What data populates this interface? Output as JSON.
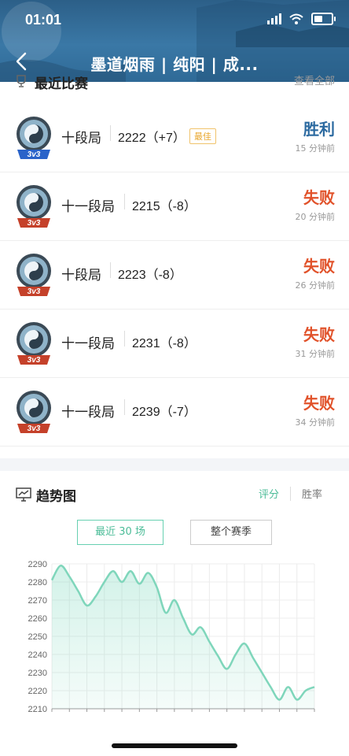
{
  "status": {
    "time": "01:01"
  },
  "header": {
    "title": "墨道烟雨 | 纯阳 | 成..."
  },
  "recent": {
    "title": "最近比赛",
    "more": "查看全部",
    "matches": [
      {
        "tier": "十段局",
        "score": "2222（+7）",
        "badge": "最佳",
        "result": "胜利",
        "result_type": "win",
        "ago": "15 分钟前",
        "mode": "3v3",
        "badge_color": "#2a63c9"
      },
      {
        "tier": "十一段局",
        "score": "2215（-8）",
        "badge": "",
        "result": "失败",
        "result_type": "lose",
        "ago": "20 分钟前",
        "mode": "3v3",
        "badge_color": "#c5412a"
      },
      {
        "tier": "十段局",
        "score": "2223（-8）",
        "badge": "",
        "result": "失败",
        "result_type": "lose",
        "ago": "26 分钟前",
        "mode": "3v3",
        "badge_color": "#c5412a"
      },
      {
        "tier": "十一段局",
        "score": "2231（-8）",
        "badge": "",
        "result": "失败",
        "result_type": "lose",
        "ago": "31 分钟前",
        "mode": "3v3",
        "badge_color": "#c5412a"
      },
      {
        "tier": "十一段局",
        "score": "2239（-7）",
        "badge": "",
        "result": "失败",
        "result_type": "lose",
        "ago": "34 分钟前",
        "mode": "3v3",
        "badge_color": "#c5412a"
      }
    ]
  },
  "trend": {
    "title": "趋势图",
    "tabs": [
      "评分",
      "胜率"
    ],
    "active_tab": "评分",
    "ranges": [
      "最近 30 场",
      "整个赛季"
    ],
    "active_range": "最近 30 场"
  },
  "colors": {
    "accent": "#4cbc98",
    "win": "#2c6aa0",
    "lose": "#e1522a"
  },
  "chart_data": {
    "type": "area",
    "title": "",
    "xlabel": "",
    "ylabel": "",
    "ylim": [
      2210,
      2290
    ],
    "yticks": [
      2290,
      2280,
      2270,
      2260,
      2250,
      2240,
      2230,
      2220,
      2210
    ],
    "grid": true,
    "x": [
      1,
      2,
      3,
      4,
      5,
      6,
      7,
      8,
      9,
      10,
      11,
      12,
      13,
      14,
      15,
      16,
      17,
      18,
      19,
      20,
      21,
      22,
      23,
      24,
      25,
      26,
      27,
      28,
      29,
      30,
      31
    ],
    "series": [
      {
        "values": [
          2281,
          2289,
          2283,
          2275,
          2267,
          2272,
          2280,
          2286,
          2280,
          2286,
          2279,
          2285,
          2277,
          2263,
          2270,
          2260,
          2251,
          2255,
          2247,
          2239,
          2232,
          2240,
          2246,
          2238,
          2230,
          2222,
          2215,
          2222,
          2215,
          2220,
          2222
        ]
      }
    ]
  }
}
